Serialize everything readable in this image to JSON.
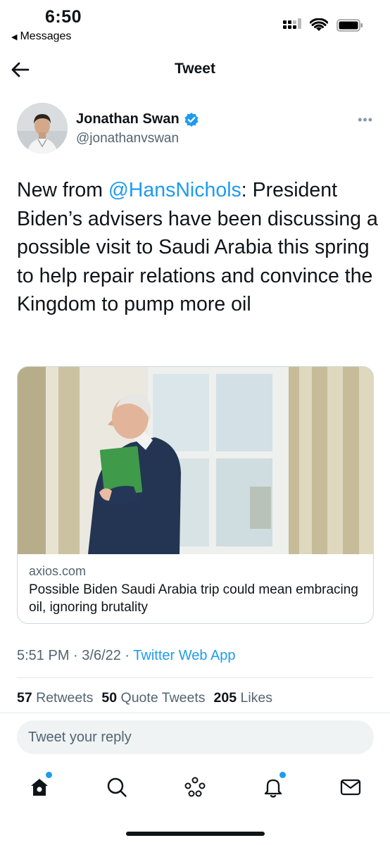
{
  "status_bar": {
    "time": "6:50",
    "back_app": "Messages"
  },
  "header": {
    "title": "Tweet"
  },
  "author": {
    "name": "Jonathan Swan",
    "handle": "@jonathanvswan",
    "verified": true
  },
  "tweet": {
    "text_before": "New from ",
    "mention": "@HansNichols",
    "text_after": ": President Biden’s advisers have been discussing a possible visit to Saudi Arabia this spring to help repair relations and convince the Kingdom to pump more oil"
  },
  "card": {
    "domain": "axios.com",
    "title": "Possible Biden Saudi Arabia trip could mean embracing oil, ignoring brutality"
  },
  "meta": {
    "time": "5:51 PM",
    "date": "3/6/22",
    "source": "Twitter Web App",
    "separator": " · "
  },
  "stats": {
    "retweets_count": "57",
    "retweets_label": "Retweets",
    "quotes_count": "50",
    "quotes_label": "Quote Tweets",
    "likes_count": "205",
    "likes_label": "Likes"
  },
  "reply": {
    "placeholder": "Tweet your reply"
  },
  "tabbar": {
    "items": [
      "home-icon",
      "search-icon",
      "spaces-icon",
      "notifications-icon",
      "messages-icon"
    ]
  },
  "colors": {
    "accent": "#1d9bf0",
    "text": "#0f1419",
    "secondary": "#536471"
  }
}
